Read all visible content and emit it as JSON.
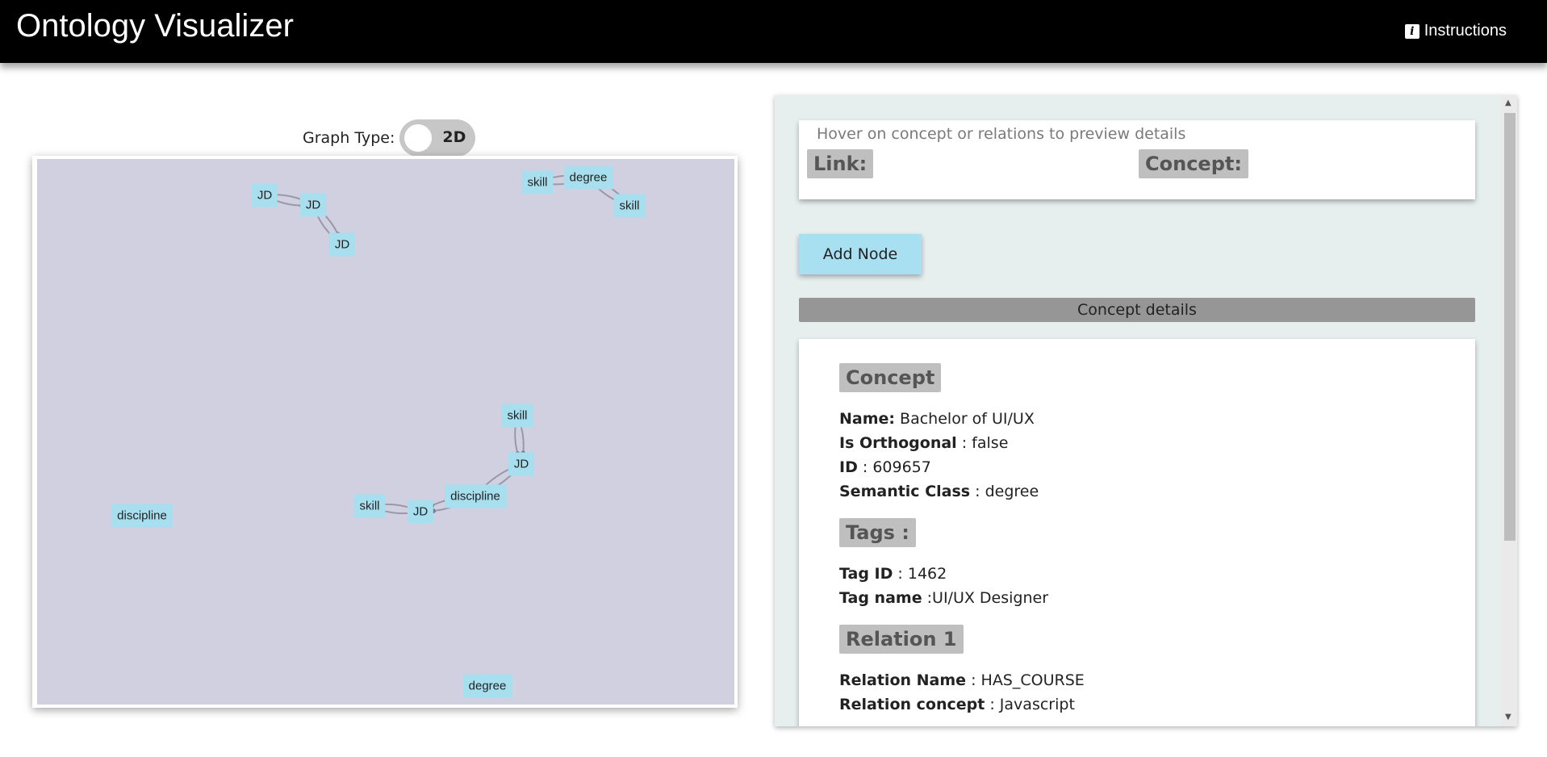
{
  "header": {
    "title": "Ontology Visualizer",
    "instructions_label": "Instructions",
    "info_icon_glyph": "i"
  },
  "graph_type": {
    "label": "Graph Type:",
    "value": "2D",
    "enabled": false
  },
  "graph": {
    "background": "#d0d0e1",
    "node_color": "#a8dfef",
    "nodes": [
      {
        "label": "JD"
      },
      {
        "label": "JD"
      },
      {
        "label": "JD"
      },
      {
        "label": "skill"
      },
      {
        "label": "degree"
      },
      {
        "label": "skill"
      },
      {
        "label": "skill"
      },
      {
        "label": "JD"
      },
      {
        "label": "discipline"
      },
      {
        "label": "JD"
      },
      {
        "label": "skill"
      },
      {
        "label": "discipline"
      },
      {
        "label": "degree"
      }
    ],
    "edges": [
      [
        0,
        1
      ],
      [
        1,
        2
      ],
      [
        3,
        4
      ],
      [
        4,
        5
      ],
      [
        6,
        7
      ],
      [
        7,
        8
      ],
      [
        8,
        9
      ],
      [
        9,
        10
      ]
    ]
  },
  "panel": {
    "hover_hint": "Hover on concept or relations to preview details",
    "link_label": "Link:",
    "concept_label": "Concept:",
    "add_node_label": "Add Node",
    "concept_details_label": "Concept details",
    "concept": {
      "heading": "Concept",
      "name_key": "Name:",
      "name_value": " Bachelor of UI/UX",
      "orthogonal_key": "Is Orthogonal",
      "orthogonal_value": " : false",
      "id_key": "ID",
      "id_value": " : 609657",
      "semantic_key": "Semantic Class",
      "semantic_value": " : degree"
    },
    "tags": {
      "heading": "Tags :",
      "tag_id_key": "Tag ID",
      "tag_id_value": " : 1462",
      "tag_name_key": "Tag name",
      "tag_name_value": " :UI/UX Designer"
    },
    "relation": {
      "heading": "Relation 1",
      "name_key": "Relation Name",
      "name_value": " : HAS_COURSE",
      "concept_key": "Relation concept",
      "concept_value": " : Javascript"
    }
  }
}
